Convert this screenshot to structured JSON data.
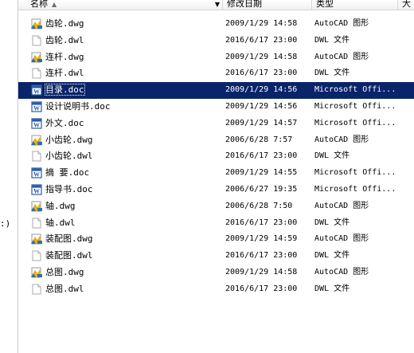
{
  "columns": {
    "name": "名称",
    "date": "修改日期",
    "type": "类型",
    "size": "大"
  },
  "nav": {
    "fragment": ":)"
  },
  "icons": {
    "dwg": "autocad-drawing-icon",
    "dwl": "blank-file-icon",
    "doc": "word-document-icon"
  },
  "files": [
    {
      "name": "齿轮.dwg",
      "date": "2009/1/29 14:58",
      "type": "AutoCAD 图形",
      "kind": "dwg"
    },
    {
      "name": "齿轮.dwl",
      "date": "2016/6/17 23:00",
      "type": "DWL 文件",
      "kind": "dwl"
    },
    {
      "name": "连杆.dwg",
      "date": "2009/1/29 14:58",
      "type": "AutoCAD 图形",
      "kind": "dwg"
    },
    {
      "name": "连杆.dwl",
      "date": "2016/6/17 23:00",
      "type": "DWL 文件",
      "kind": "dwl"
    },
    {
      "name": "目录.doc",
      "date": "2009/1/29 14:56",
      "type": "Microsoft Offi...",
      "kind": "doc",
      "selected": true
    },
    {
      "name": "设计说明书.doc",
      "date": "2009/1/29 14:56",
      "type": "Microsoft Offi...",
      "kind": "doc"
    },
    {
      "name": "外文.doc",
      "date": "2009/1/29 14:57",
      "type": "Microsoft Offi...",
      "kind": "doc"
    },
    {
      "name": "小齿轮.dwg",
      "date": "2006/6/28 7:57",
      "type": "AutoCAD 图形",
      "kind": "dwg"
    },
    {
      "name": "小齿轮.dwl",
      "date": "2016/6/17 23:00",
      "type": "DWL 文件",
      "kind": "dwl"
    },
    {
      "name": "摘 要.doc",
      "date": "2009/1/29 14:55",
      "type": "Microsoft Offi...",
      "kind": "doc"
    },
    {
      "name": "指导书.doc",
      "date": "2006/6/27 19:35",
      "type": "Microsoft Offi...",
      "kind": "doc"
    },
    {
      "name": "轴.dwg",
      "date": "2006/6/28 7:50",
      "type": "AutoCAD 图形",
      "kind": "dwg"
    },
    {
      "name": "轴.dwl",
      "date": "2016/6/17 23:00",
      "type": "DWL 文件",
      "kind": "dwl"
    },
    {
      "name": "装配图.dwg",
      "date": "2009/1/29 14:59",
      "type": "AutoCAD 图形",
      "kind": "dwg"
    },
    {
      "name": "装配图.dwl",
      "date": "2016/6/17 23:00",
      "type": "DWL 文件",
      "kind": "dwl"
    },
    {
      "name": "总图.dwg",
      "date": "2009/1/29 14:58",
      "type": "AutoCAD 图形",
      "kind": "dwg"
    },
    {
      "name": "总图.dwl",
      "date": "2016/6/17 23:00",
      "type": "DWL 文件",
      "kind": "dwl"
    }
  ],
  "colors": {
    "selection": "#0a246a",
    "selection_text": "#ffffff",
    "header_border": "#d5d5d5"
  }
}
